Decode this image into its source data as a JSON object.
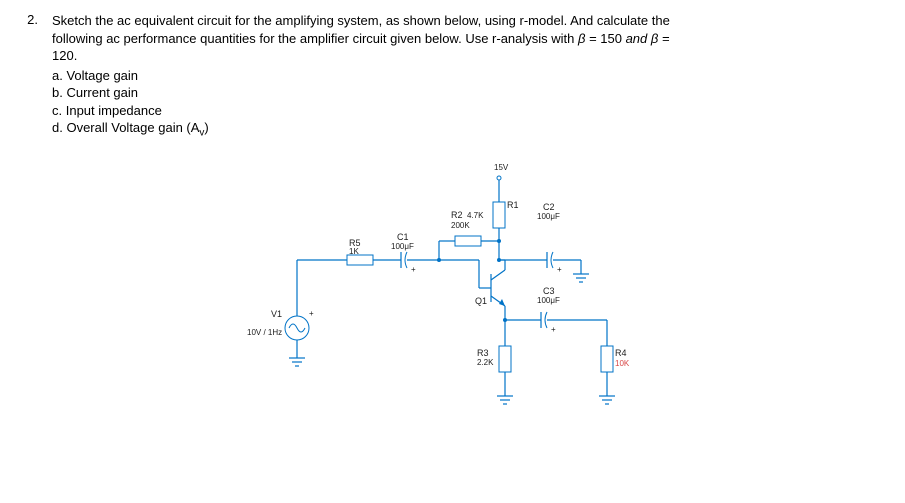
{
  "question": {
    "number": "2.",
    "prompt_l1": "Sketch the ac equivalent circuit for the amplifying system, as shown below, using r-model. And calculate the",
    "prompt_l2": "following ac performance quantities for the amplifier circuit given below. Use r-analysis with ",
    "beta1_lhs": "β",
    "beta1_eq": " = 150 ",
    "and": "and",
    "beta2": " β =",
    "prompt_l3": "120.",
    "a": "a. Voltage gain",
    "b": "b. Current gain",
    "c": "c. Input impedance",
    "d_prefix": "d. Overall Voltage gain (A",
    "d_sub": "v",
    "d_suffix": ")"
  },
  "circuit": {
    "supply": "15V",
    "V1_name": "V1",
    "V1_val": "10V / 1Hz",
    "R5_name": "R5",
    "R5_val": "1K",
    "C1_name": "C1",
    "C1_val": "100μF",
    "R1_name": "R1",
    "R1_val": "4.7K",
    "R2_name": "R2",
    "R2_val": "200K",
    "C2_name": "C2",
    "C2_val": "100μF",
    "C3_name": "C3",
    "C3_val": "100μF",
    "R3_name": "R3",
    "R3_val": "2.2K",
    "R4_name": "R4",
    "R4_val": "10K",
    "Q1": "Q1",
    "plus": "+"
  }
}
